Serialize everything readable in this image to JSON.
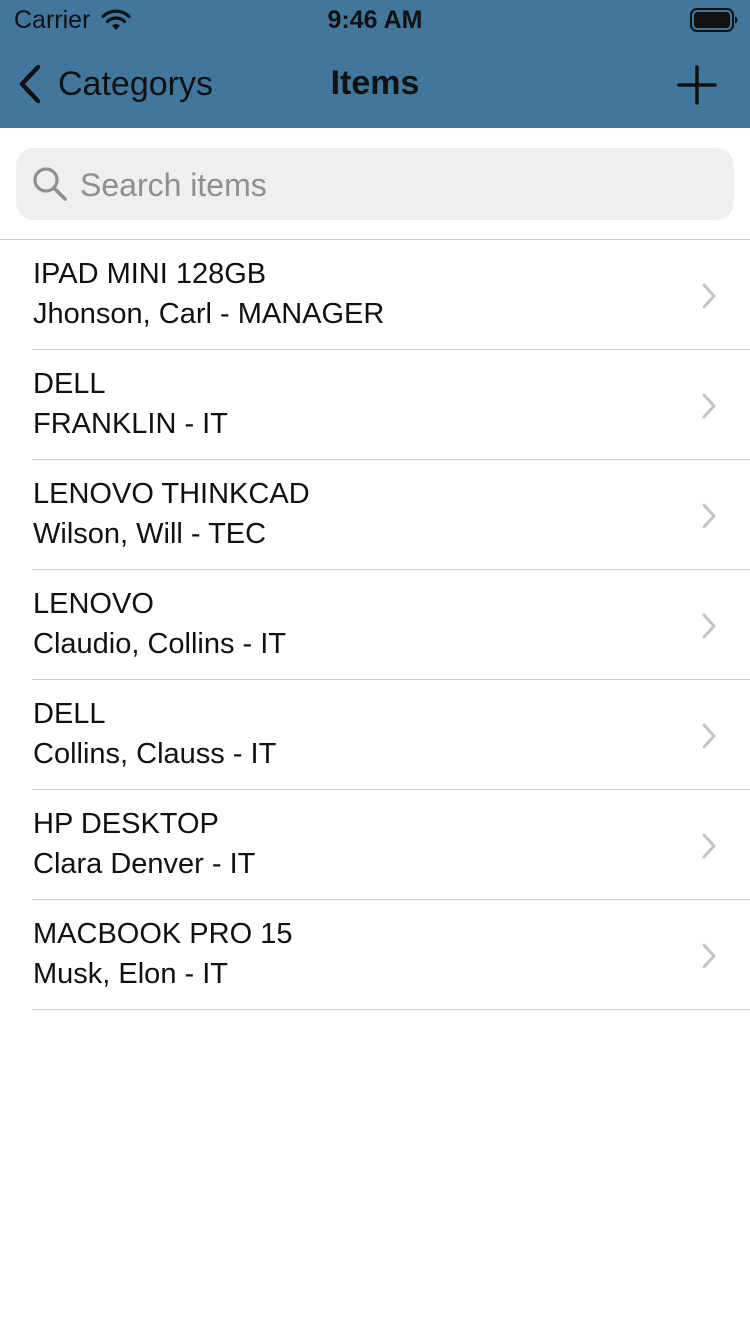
{
  "status_bar": {
    "carrier": "Carrier",
    "time": "9:46 AM",
    "icons": [
      "wifi-icon",
      "battery-icon"
    ]
  },
  "nav": {
    "back_label": "Categorys",
    "title": "Items",
    "add_icon": "plus-icon",
    "bar_color": "#41779d"
  },
  "search": {
    "placeholder": "Search items",
    "value": ""
  },
  "items": [
    {
      "title": "IPAD MINI 128GB",
      "subtitle": "Jhonson, Carl - MANAGER"
    },
    {
      "title": "DELL",
      "subtitle": "FRANKLIN - IT"
    },
    {
      "title": "LENOVO THINKCAD",
      "subtitle": "Wilson, Will - TEC"
    },
    {
      "title": "LENOVO",
      "subtitle": "Claudio, Collins - IT"
    },
    {
      "title": "DELL",
      "subtitle": "Collins, Clauss - IT"
    },
    {
      "title": "HP DESKTOP",
      "subtitle": "Clara Denver - IT"
    },
    {
      "title": "MACBOOK PRO 15",
      "subtitle": "Musk, Elon - IT"
    }
  ]
}
